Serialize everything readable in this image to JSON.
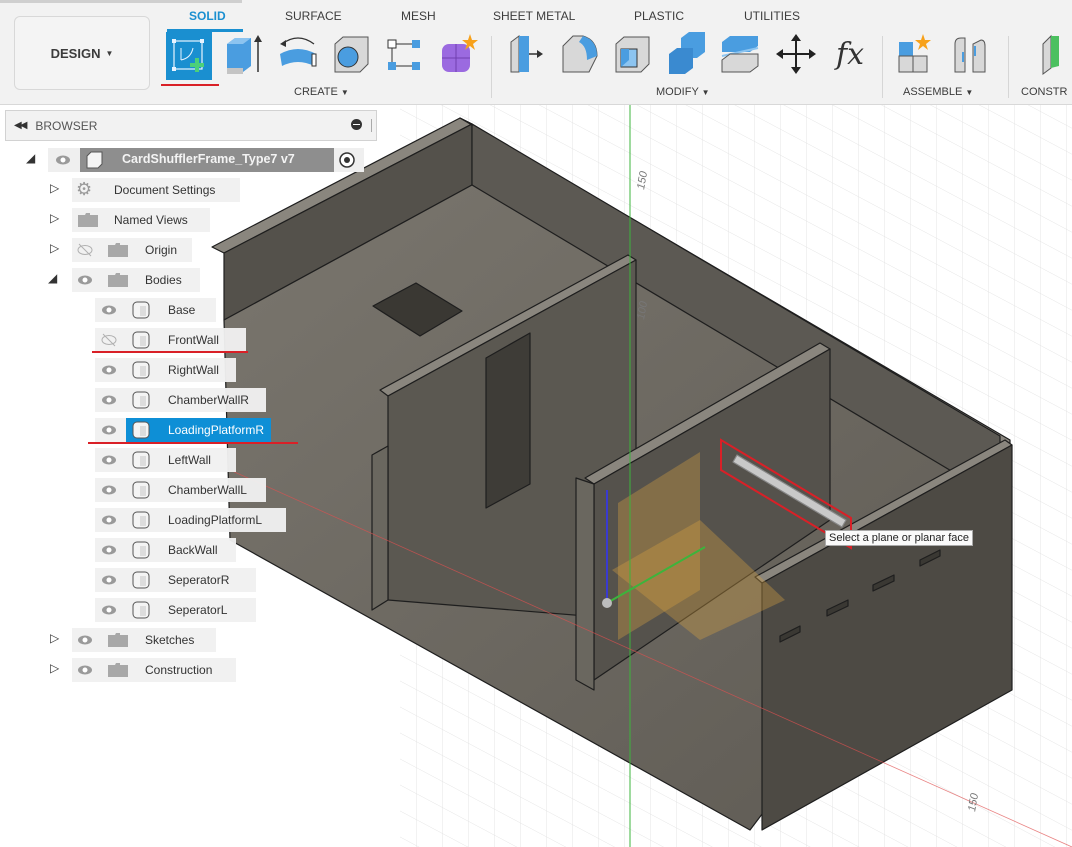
{
  "toolbar": {
    "workspace_label": "DESIGN",
    "tabs": [
      {
        "label": "SOLID",
        "active": true
      },
      {
        "label": "SURFACE",
        "active": false
      },
      {
        "label": "MESH",
        "active": false
      },
      {
        "label": "SHEET METAL",
        "active": false
      },
      {
        "label": "PLASTIC",
        "active": false
      },
      {
        "label": "UTILITIES",
        "active": false
      }
    ],
    "groups": {
      "create": {
        "label": "CREATE",
        "tools": [
          "create-sketch-icon",
          "extrude-icon",
          "revolve-icon",
          "hole-icon",
          "pattern-icon",
          "create-form-icon"
        ]
      },
      "modify": {
        "label": "MODIFY",
        "tools": [
          "press-pull-icon",
          "fillet-icon",
          "shell-icon",
          "combine-icon",
          "split-body-icon",
          "move-icon",
          "parameters-icon"
        ]
      },
      "assemble": {
        "label": "ASSEMBLE",
        "tools": [
          "new-component-icon",
          "joint-icon"
        ]
      },
      "construct": {
        "label": "CONSTR",
        "tools": [
          "offset-plane-icon"
        ]
      }
    },
    "parameters_glyph": "fx",
    "accent_color": "#1a8fd0"
  },
  "browser": {
    "title": "BROWSER",
    "root": {
      "label": "CardShufflerFrame_Type7 v7",
      "visible": true
    },
    "folders": [
      {
        "label": "Document Settings",
        "icon": "gear-icon",
        "expanded": false,
        "has_eye": false
      },
      {
        "label": "Named Views",
        "icon": "folder-icon",
        "expanded": false,
        "has_eye": false
      },
      {
        "label": "Origin",
        "icon": "folder-icon",
        "expanded": false,
        "has_eye": true,
        "visible": false
      },
      {
        "label": "Bodies",
        "icon": "folder-icon",
        "expanded": true,
        "has_eye": true,
        "visible": true
      }
    ],
    "bodies": [
      {
        "label": "Base",
        "visible": true,
        "selected": false
      },
      {
        "label": "FrontWall",
        "visible": false,
        "selected": false
      },
      {
        "label": "RightWall",
        "visible": true,
        "selected": false
      },
      {
        "label": "ChamberWallR",
        "visible": true,
        "selected": false
      },
      {
        "label": "LoadingPlatformR",
        "visible": true,
        "selected": true
      },
      {
        "label": "LeftWall",
        "visible": true,
        "selected": false
      },
      {
        "label": "ChamberWallL",
        "visible": true,
        "selected": false
      },
      {
        "label": "LoadingPlatformL",
        "visible": true,
        "selected": false
      },
      {
        "label": "BackWall",
        "visible": true,
        "selected": false
      },
      {
        "label": "SeperatorR",
        "visible": true,
        "selected": false
      },
      {
        "label": "SeperatorL",
        "visible": true,
        "selected": false
      }
    ],
    "trailing_folders": [
      {
        "label": "Sketches",
        "expanded": false,
        "visible": true
      },
      {
        "label": "Construction",
        "expanded": false,
        "visible": true
      }
    ],
    "selection_color": "#0e8fd6"
  },
  "viewport": {
    "tooltip": "Select a plane or planar face",
    "grid_labels": {
      "z_150": "150",
      "z_100": "100",
      "x_150": "150"
    },
    "axis_colors": {
      "x": "#e05050",
      "y": "#3cb43c",
      "z": "#3a3ad0"
    },
    "highlight_color": "#d92027"
  }
}
